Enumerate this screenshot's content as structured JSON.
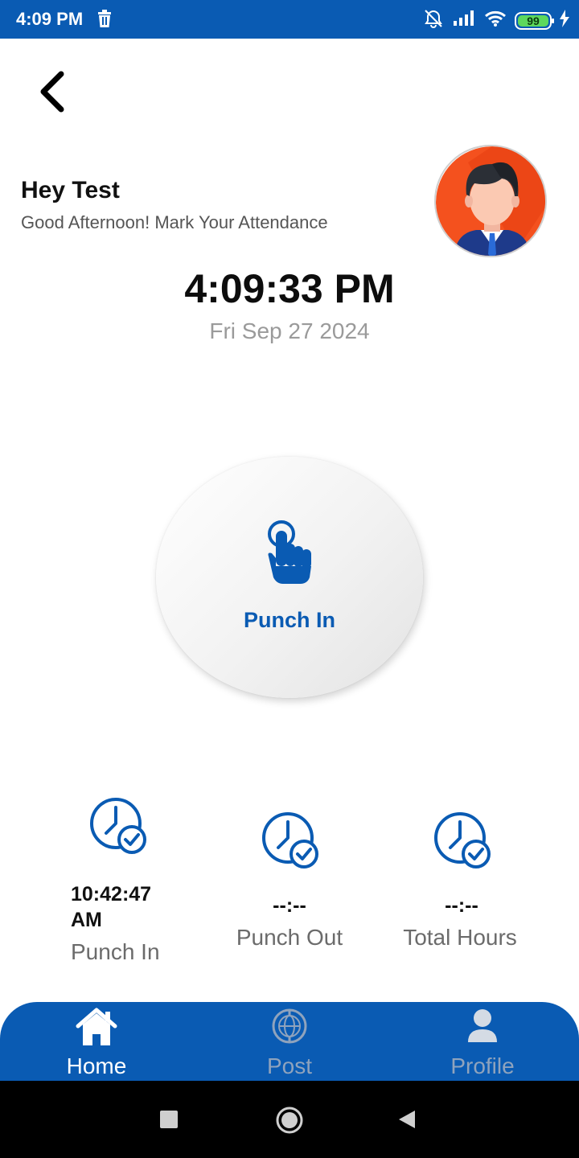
{
  "status_bar": {
    "time": "4:09 PM",
    "battery": "99",
    "battery_level": 0.99,
    "bar_color": "#0a5bb3",
    "icons": [
      "trash-icon",
      "alarm-off-icon",
      "signal-icon",
      "wifi-icon",
      "battery-icon",
      "charging-icon"
    ]
  },
  "header": {
    "back_icon": "chevron-left-icon",
    "greeting": "Hey Test",
    "subgreeting": "Good Afternoon! Mark Your Attendance",
    "avatar_icon": "user-avatar"
  },
  "clock": {
    "time": "4:09:33 PM",
    "date": "Fri Sep 27 2024"
  },
  "punch_button": {
    "label": "Punch In",
    "icon": "tap-hand-icon",
    "color": "#0a5bb3"
  },
  "stats": [
    {
      "value": "10:42:47 AM",
      "label": "Punch In",
      "icon": "clock-check-icon"
    },
    {
      "value": "--:--",
      "label": "Punch Out",
      "icon": "clock-check-icon"
    },
    {
      "value": "--:--",
      "label": "Total Hours",
      "icon": "clock-check-icon"
    }
  ],
  "bottom_nav": {
    "items": [
      {
        "label": "Home",
        "icon": "home-icon",
        "active": true
      },
      {
        "label": "Post",
        "icon": "globe-icon",
        "active": false
      },
      {
        "label": "Profile",
        "icon": "user-icon",
        "active": false
      }
    ],
    "active_color": "#ffffff",
    "inactive_color": "#8fa3bd"
  },
  "system_nav": {
    "icons": [
      "recents-square-icon",
      "home-circle-icon",
      "back-triangle-icon"
    ]
  }
}
